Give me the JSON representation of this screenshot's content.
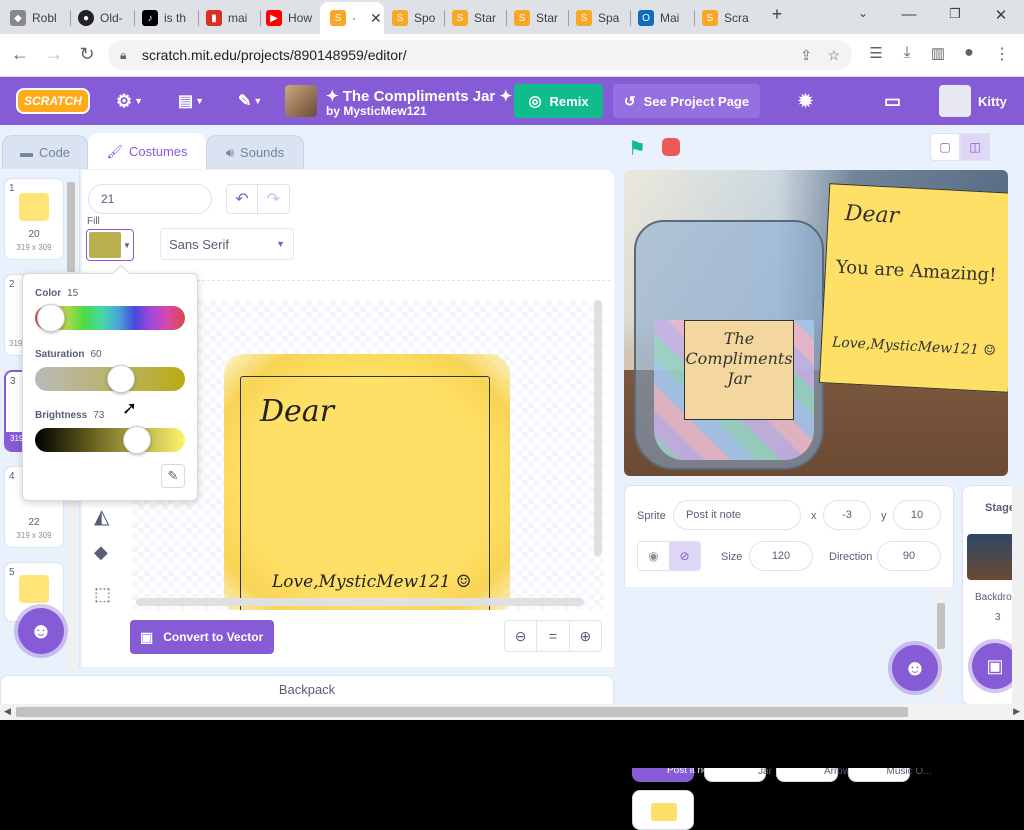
{
  "browser": {
    "tabs": [
      {
        "label": "Robl",
        "icon": "roblox-icon",
        "color": "#777"
      },
      {
        "label": "Old-",
        "icon": "github-icon",
        "color": "#222"
      },
      {
        "label": "is th",
        "icon": "tiktok-icon",
        "color": "#000"
      },
      {
        "label": "mai",
        "icon": "bookmark-icon",
        "color": "#d93025"
      },
      {
        "label": "How",
        "icon": "youtube-icon",
        "color": "#ff0000"
      },
      {
        "label": "·",
        "icon": "scratch-icon",
        "color": "#f9a825"
      },
      {
        "label": "Spo",
        "icon": "scratch-icon",
        "color": "#f9a825"
      },
      {
        "label": "Star",
        "icon": "scratch-icon",
        "color": "#f9a825"
      },
      {
        "label": "Star",
        "icon": "scratch-icon",
        "color": "#f9a825"
      },
      {
        "label": "Spa",
        "icon": "scratch-icon",
        "color": "#f9a825"
      },
      {
        "label": "Mai",
        "icon": "outlook-icon",
        "color": "#0f6cbd"
      },
      {
        "label": "Scra",
        "icon": "scratch-icon",
        "color": "#f9a825"
      }
    ],
    "url": "scratch.mit.edu/projects/890148959/editor/"
  },
  "menu": {
    "logo": "SCRATCH",
    "project_title": "✦ The Compliments Jar ✦",
    "author": "by MysticMew121",
    "remix": "Remix",
    "see_project_page": "See Project Page",
    "username": "Kitty"
  },
  "editor_tabs": {
    "code": "Code",
    "costumes": "Costumes",
    "sounds": "Sounds"
  },
  "costumes": [
    {
      "num": "1",
      "name": "20",
      "size": "319 x 309"
    },
    {
      "num": "2",
      "name": "",
      "size": "319"
    },
    {
      "num": "3",
      "name": "",
      "size": "319"
    },
    {
      "num": "4",
      "name": "22",
      "size": "319 x 309"
    },
    {
      "num": "5",
      "name": "",
      "size": ""
    }
  ],
  "paint": {
    "costume_name": "21",
    "fill_label": "Fill",
    "fill_color": "#b9b04e",
    "font": "Sans Serif",
    "convert_button": "Convert to Vector",
    "zoom_equal": "="
  },
  "color_picker": {
    "color_label": "Color",
    "color_value": "15",
    "saturation_label": "Saturation",
    "saturation_value": "60",
    "brightness_label": "Brightness",
    "brightness_value": "73"
  },
  "canvas": {
    "note_dear": "Dear",
    "note_signature": "Love,MysticMew121 ☺"
  },
  "stage": {
    "jar_label": "The Compliments Jar",
    "note_dear": "Dear",
    "note_text": "You are Amazing!",
    "note_signature": "Love,MysticMew121 ☺"
  },
  "sprite_info": {
    "sprite_label": "Sprite",
    "sprite_name": "Post it note",
    "x_label": "x",
    "x_value": "-3",
    "y_label": "y",
    "y_value": "10",
    "size_label": "Size",
    "size_value": "120",
    "direction_label": "Direction",
    "direction_value": "90"
  },
  "sprites": [
    {
      "name": "Post it note"
    },
    {
      "name": "Jar"
    },
    {
      "name": "Arrow"
    },
    {
      "name": "Music O..."
    }
  ],
  "stage_panel": {
    "label": "Stage",
    "backdrops_label": "Backdro",
    "backdrops_count": "3"
  },
  "backpack": "Backpack",
  "colors": {
    "scratch_purple": "#855cd6",
    "remix_green": "#0fbd8c",
    "sticky_yellow": "#ffe066"
  }
}
